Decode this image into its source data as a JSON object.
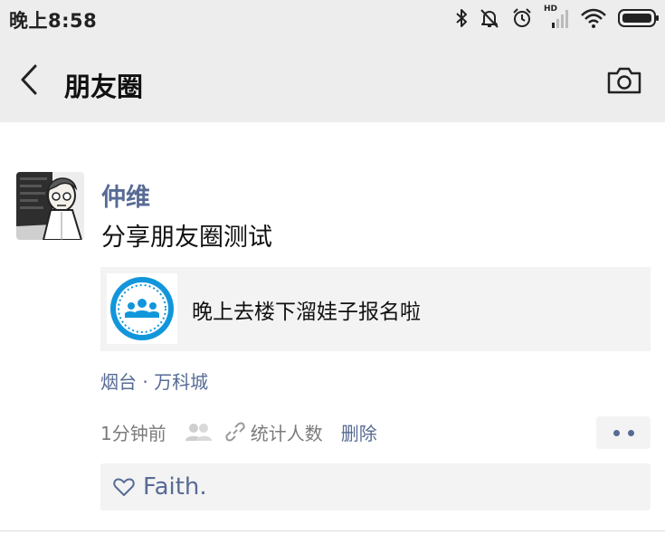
{
  "status_bar": {
    "time": "晚上8:58",
    "network_badge": "HD",
    "icons": [
      "bluetooth-icon",
      "mute-icon",
      "alarm-icon",
      "signal-icon",
      "wifi-icon",
      "battery-icon"
    ]
  },
  "nav": {
    "title": "朋友圈",
    "back_icon": "chevron-left-icon",
    "camera_icon": "camera-icon"
  },
  "post": {
    "author": "仲维",
    "text": "分享朋友圈测试",
    "link_card": {
      "title": "晚上去楼下溜娃子报名啦",
      "thumb_icon": "group-people-icon",
      "thumb_color": "#1296db"
    },
    "location": "烟台 · 万科城",
    "time_ago": "1分钟前",
    "stat_label": "统计人数",
    "delete_label": "删除",
    "likes": [
      "Faith."
    ]
  },
  "colors": {
    "link_blue": "#576b95",
    "header_bg": "#ededed",
    "card_bg": "#f3f3f3"
  }
}
